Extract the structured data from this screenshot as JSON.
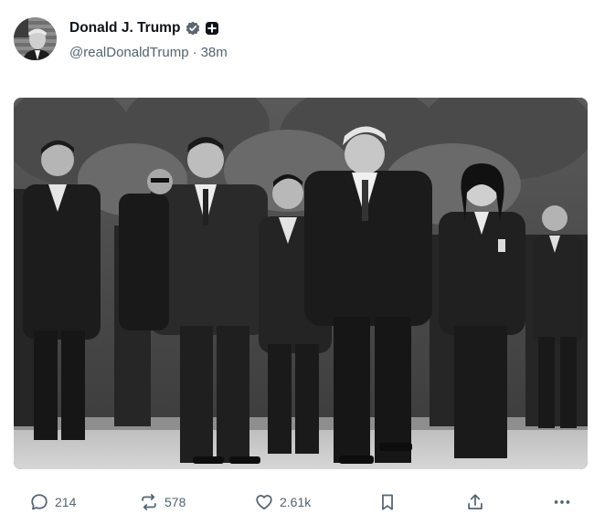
{
  "author": {
    "display_name": "Donald J. Trump",
    "handle": "@realDonaldTrump",
    "separator": "·",
    "time": "38m",
    "verified_icon": "verified-badge-icon",
    "extra_badge_icon": "plus-badge-icon",
    "avatar_icon": "avatar-photo"
  },
  "media": {
    "kind": "photo",
    "style": "black-and-white",
    "icon": "photo-image"
  },
  "actions": {
    "reply": {
      "icon": "reply-icon",
      "count": "214"
    },
    "repost": {
      "icon": "repost-icon",
      "count": "578"
    },
    "like": {
      "icon": "heart-icon",
      "count": "2.61k"
    },
    "bookmark": {
      "icon": "bookmark-icon"
    },
    "share": {
      "icon": "share-icon"
    },
    "more": {
      "icon": "more-icon"
    }
  },
  "colors": {
    "text_primary": "#0f1419",
    "text_secondary": "#536471",
    "badge": "#5b6670"
  }
}
